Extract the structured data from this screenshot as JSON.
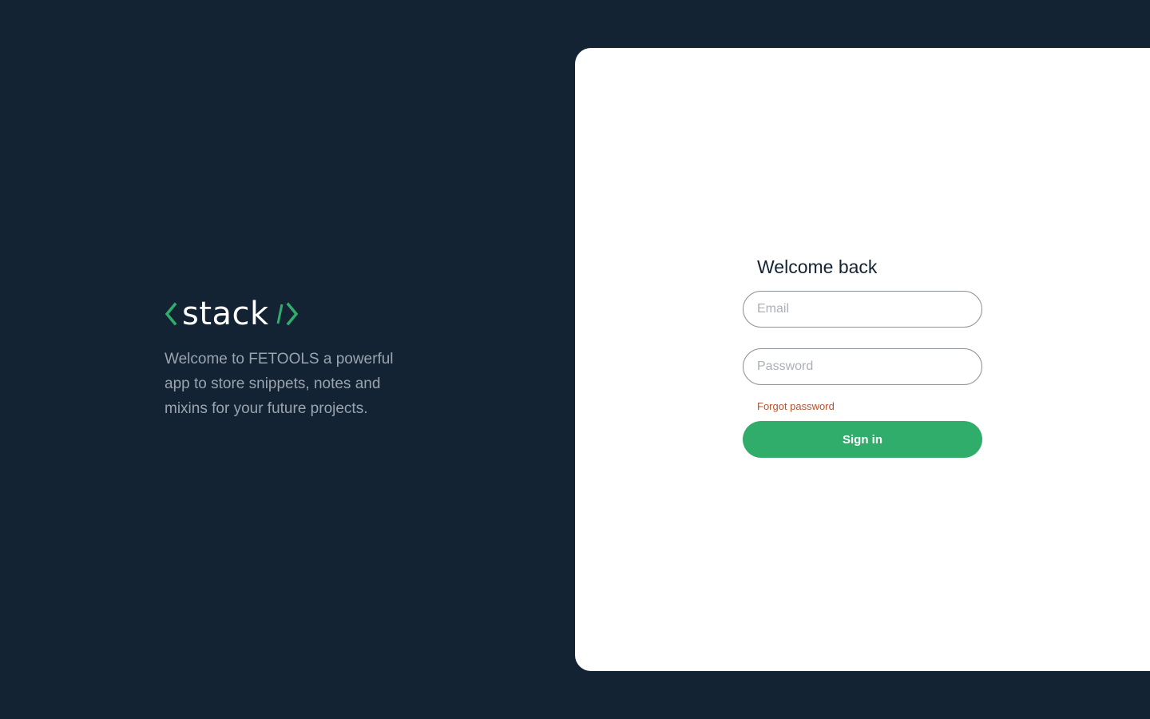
{
  "brand": {
    "logo_text": "stack",
    "logo_open_icon": "chevron-left-icon",
    "logo_close_icon": "slash-chevron-right-icon",
    "accent_color": "#31ad6b",
    "tagline": "Welcome to FETOOLS a powerful app to store snippets, notes and mixins for your future projects."
  },
  "login": {
    "title": "Welcome back",
    "email_placeholder": "Email",
    "email_value": "",
    "password_placeholder": "Password",
    "password_value": "",
    "forgot_label": "Forgot password",
    "submit_label": "Sign in"
  },
  "colors": {
    "background": "#132333",
    "card": "#ffffff",
    "primary_button": "#31ad6b",
    "forgot_link": "#b5522f"
  }
}
